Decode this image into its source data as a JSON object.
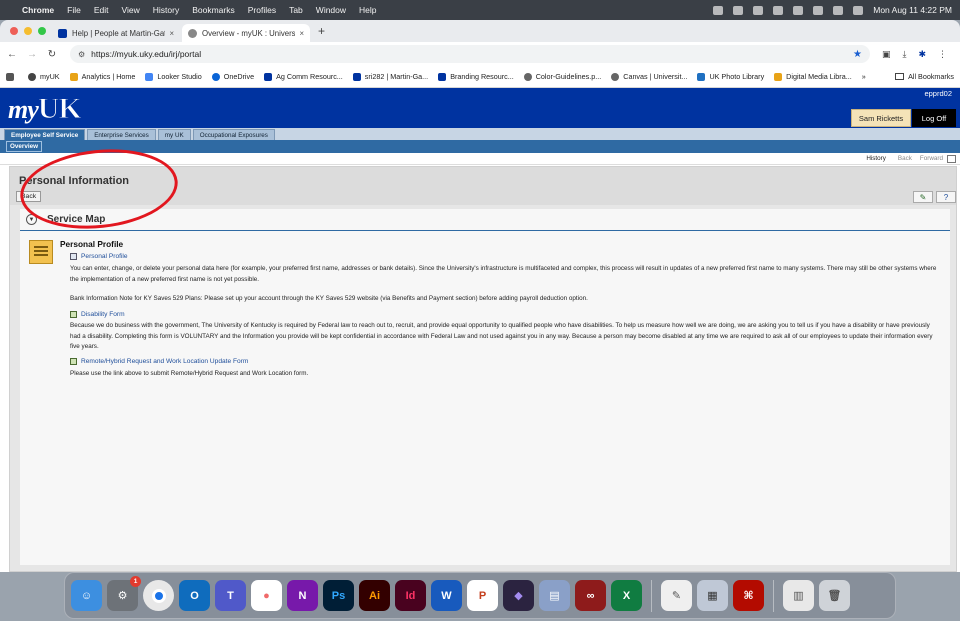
{
  "menubar": {
    "app": "Chrome",
    "items": [
      "File",
      "Edit",
      "View",
      "History",
      "Bookmarks",
      "Profiles",
      "Tab",
      "Window",
      "Help"
    ],
    "clock": "Mon Aug 11  4:22 PM"
  },
  "tabs": [
    {
      "label": "Help | People at Martin-Gatt",
      "color": "#0033a0"
    },
    {
      "label": "Overview - myUK : University",
      "color": "#888888"
    }
  ],
  "url": "https://myuk.uky.edu/irj/portal",
  "bookmarks": [
    {
      "label": "myUK",
      "color": "#444444"
    },
    {
      "label": "Analytics | Home",
      "color": "#e8a317"
    },
    {
      "label": "Looker Studio",
      "color": "#4285f4"
    },
    {
      "label": "OneDrive",
      "color": "#0a64d6"
    },
    {
      "label": "Ag Comm Resourc...",
      "color": "#0033a0"
    },
    {
      "label": "sri282 | Martin-Ga...",
      "color": "#0033a0"
    },
    {
      "label": "Branding Resourc...",
      "color": "#0033a0"
    },
    {
      "label": "Color-Guidelines.p...",
      "color": "#666666"
    },
    {
      "label": "Canvas | Universit...",
      "color": "#666666"
    },
    {
      "label": "UK Photo Library",
      "color": "#1f70c1"
    },
    {
      "label": "Digital Media Libra...",
      "color": "#e8a317"
    }
  ],
  "all_bookmarks": "All Bookmarks",
  "portal": {
    "system_id": "epprd02",
    "user_name": "Sam Ricketts",
    "logoff": "Log Off",
    "top_tabs": [
      "Employee Self Service",
      "Enterprise Services",
      "my UK",
      "Occupational Exposures"
    ],
    "sub_tab": "Overview",
    "history": "History",
    "back": "Back",
    "forward": "Forward"
  },
  "content": {
    "page_title": "Personal Information",
    "back_button": "Back",
    "service_map": "Service Map",
    "section_title": "Personal Profile",
    "link1": "Personal Profile",
    "desc1": "You can enter, change, or delete your personal data here (for example, your preferred first name, addresses or bank details). Since the University's infrastructure is multifaceted and complex, this process will result in updates of a new preferred first name to many systems. There may still be other systems where the implementation of a new preferred first name is not yet possible.",
    "bank_note": "Bank Information Note for KY Saves 529 Plans: Please set up your account through the KY Saves 529 website (via Benefits and Payment section) before adding payroll deduction option.",
    "link2": "Disability Form",
    "desc2": "Because we do business with the government, The University of Kentucky is required by Federal law to reach out to, recruit, and provide equal opportunity to qualified people who have disabilities. To help us measure how well we are doing, we are asking you to tell us if you have a disability or have previously had a disability. Completing this form is VOLUNTARY and the Information you provide will be kept confidential in accordance with Federal Law and not used against you in any way. Because a person may become disabled at any time we are required to ask all of our employees to update their information every five years.",
    "link3": "Remote/Hybrid Request and Work Location Update Form",
    "desc3": "Please use the link above to submit Remote/Hybrid Request and Work Location form."
  },
  "dock": {
    "settings_badge": "1",
    "apps": [
      {
        "name": "finder",
        "glyph": "",
        "color": "#3d8fe0"
      },
      {
        "name": "settings",
        "glyph": "",
        "color": "#6d7278"
      },
      {
        "name": "chrome",
        "glyph": "",
        "color": "#e8e8e8"
      },
      {
        "name": "outlook",
        "glyph": "O",
        "color": "#0f6cbd"
      },
      {
        "name": "teams",
        "glyph": "T",
        "color": "#5059c9"
      },
      {
        "name": "asana",
        "glyph": "",
        "color": "#f06a6a"
      },
      {
        "name": "onenote",
        "glyph": "N",
        "color": "#7719aa"
      },
      {
        "name": "photoshop",
        "glyph": "Ps",
        "color": "#001e36"
      },
      {
        "name": "illustrator",
        "glyph": "Ai",
        "color": "#330000"
      },
      {
        "name": "indesign",
        "glyph": "Id",
        "color": "#49021f"
      },
      {
        "name": "word",
        "glyph": "W",
        "color": "#185abd"
      },
      {
        "name": "powerpoint",
        "glyph": "P",
        "color": "#c43e1c"
      },
      {
        "name": "obsidian",
        "glyph": "",
        "color": "#5a3fb0"
      },
      {
        "name": "archive",
        "glyph": "",
        "color": "#8aa0c8"
      },
      {
        "name": "relay",
        "glyph": "",
        "color": "#8e1b1b"
      },
      {
        "name": "excel",
        "glyph": "X",
        "color": "#107c41"
      },
      {
        "name": "textedit",
        "glyph": "",
        "color": "#efefef"
      },
      {
        "name": "preview",
        "glyph": "",
        "color": "#bfc8d6"
      },
      {
        "name": "acrobat",
        "glyph": "",
        "color": "#b30b00"
      },
      {
        "name": "documents",
        "glyph": "",
        "color": "#e8e8e8"
      },
      {
        "name": "trash",
        "glyph": "",
        "color": "#cfd3d8"
      }
    ]
  }
}
